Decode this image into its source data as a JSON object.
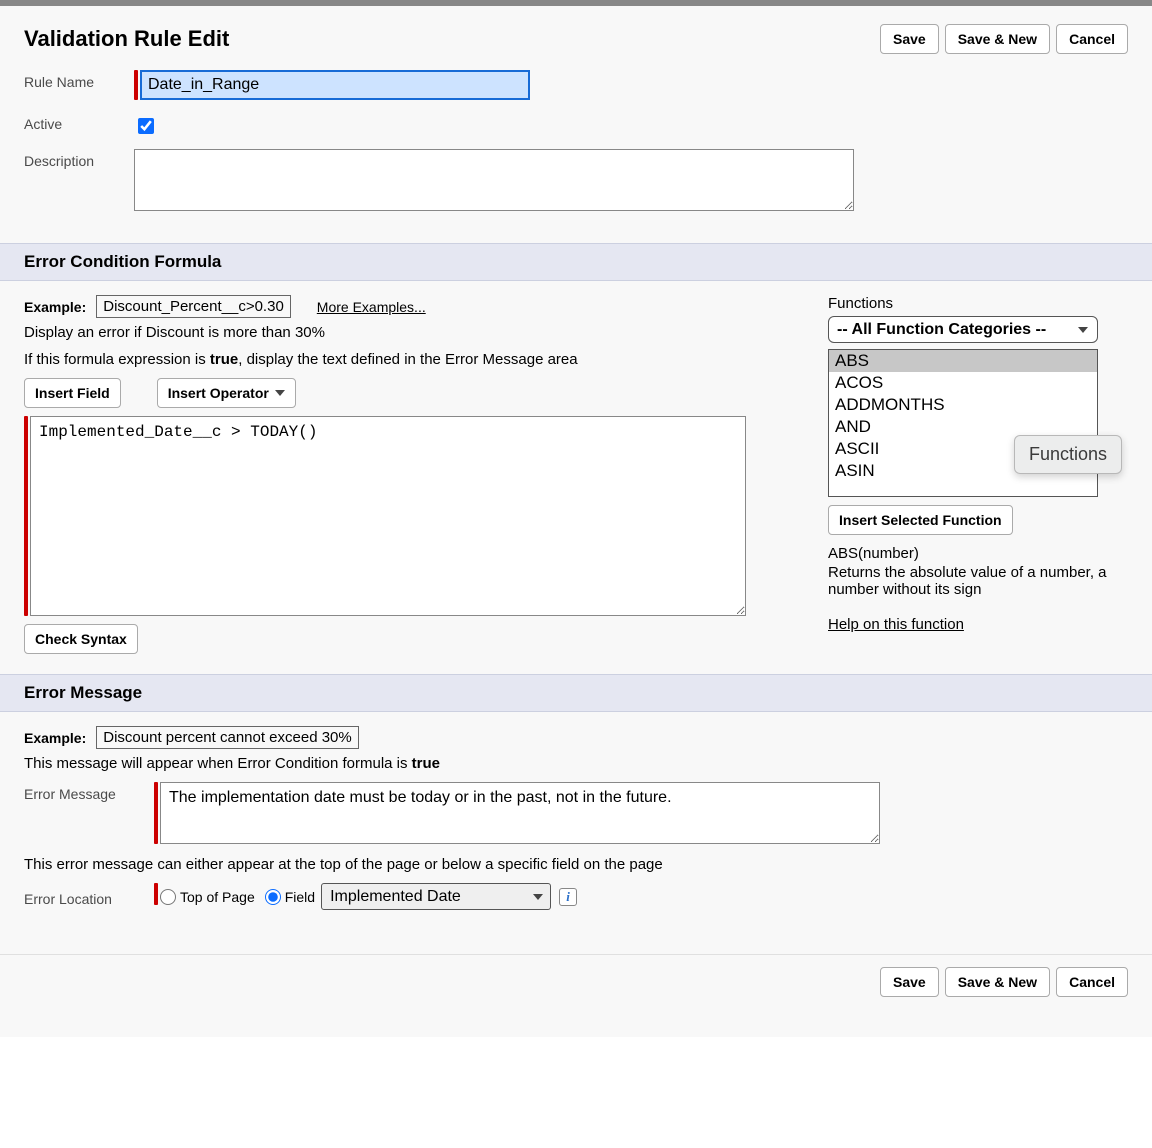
{
  "header": {
    "title": "Validation Rule Edit",
    "buttons": {
      "save": "Save",
      "save_new": "Save & New",
      "cancel": "Cancel"
    }
  },
  "form": {
    "ruleName": {
      "label": "Rule Name",
      "value": "Date_in_Range"
    },
    "active": {
      "label": "Active",
      "checked": true
    },
    "description": {
      "label": "Description",
      "value": ""
    }
  },
  "formulaSection": {
    "heading": "Error Condition Formula",
    "exampleLabel": "Example:",
    "exampleCode": "Discount_Percent__c>0.30",
    "moreExamples": "More Examples...",
    "exampleDesc": "Display an error if Discount is more than 30%",
    "instructionPrefix": "If this formula expression is ",
    "instructionBold": "true",
    "instructionSuffix": ", display the text defined in the Error Message area",
    "insertField": "Insert Field",
    "insertOperator": "Insert Operator",
    "formula": "Implemented_Date__c > TODAY()",
    "checkSyntax": "Check Syntax"
  },
  "functions": {
    "label": "Functions",
    "category": "-- All Function Categories --",
    "list": [
      "ABS",
      "ACOS",
      "ADDMONTHS",
      "AND",
      "ASCII",
      "ASIN"
    ],
    "selected": "ABS",
    "insertBtn": "Insert Selected Function",
    "signature": "ABS(number)",
    "description": "Returns the absolute value of a number, a number without its sign",
    "helpLink": "Help on this function",
    "tooltip": "Functions"
  },
  "errorMessage": {
    "heading": "Error Message",
    "exampleLabel": "Example:",
    "exampleText": "Discount percent cannot exceed 30%",
    "notePrefix": "This message will appear when Error Condition formula is ",
    "noteBold": "true",
    "fieldLabel": "Error Message",
    "value": "The implementation date must be today or in the past, not in the future.",
    "locationNote": "This error message can either appear at the top of the page or below a specific field on the page",
    "locationLabel": "Error Location",
    "radioTop": "Top of Page",
    "radioField": "Field",
    "fieldOption": "Implemented Date"
  },
  "footer": {
    "save": "Save",
    "save_new": "Save & New",
    "cancel": "Cancel"
  }
}
